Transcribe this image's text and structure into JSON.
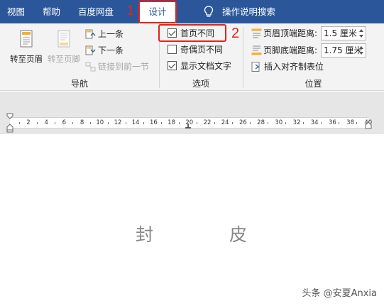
{
  "tabs": [
    {
      "id": "view",
      "label": "视图"
    },
    {
      "id": "help",
      "label": "帮助"
    },
    {
      "id": "netdisk",
      "label": "百度网盘"
    },
    {
      "id": "design",
      "label": "设计"
    },
    {
      "id": "search",
      "label": "操作说明搜索"
    }
  ],
  "navigation": {
    "goto_header": "转至页眉",
    "goto_footer": "转至页脚",
    "previous": "上一条",
    "next": "下一条",
    "link_previous": "链接到前一节",
    "group_label": "导航"
  },
  "options": {
    "first_page_different": {
      "label": "首页不同",
      "checked": true
    },
    "odd_even_different": {
      "label": "奇偶页不同",
      "checked": false
    },
    "show_doc_text": {
      "label": "显示文档文字",
      "checked": true
    },
    "group_label": "选项"
  },
  "position": {
    "header_top_label": "页眉顶端距离:",
    "header_top_value": "1.5 厘米",
    "footer_bottom_label": "页脚底端距离:",
    "footer_bottom_value": "1.75 厘米",
    "insert_align_tab": "插入对齐制表位",
    "group_label": "位置"
  },
  "annotations": {
    "step1": "1",
    "step2": "2",
    "color": "#e2231a"
  },
  "ruler": {
    "numbers": [
      "2",
      "4",
      "6",
      "8",
      "10",
      "12",
      "14",
      "16",
      "18",
      "20",
      "22",
      "24",
      "26",
      "28",
      "30",
      "32",
      "34",
      "36",
      "38",
      "40"
    ]
  },
  "document": {
    "char1": "封",
    "char2": "皮"
  },
  "watermark": "头条 @安夏Anxia",
  "colors": {
    "tabbar": "#2b579a",
    "ribbon": "#f3f3f3"
  }
}
